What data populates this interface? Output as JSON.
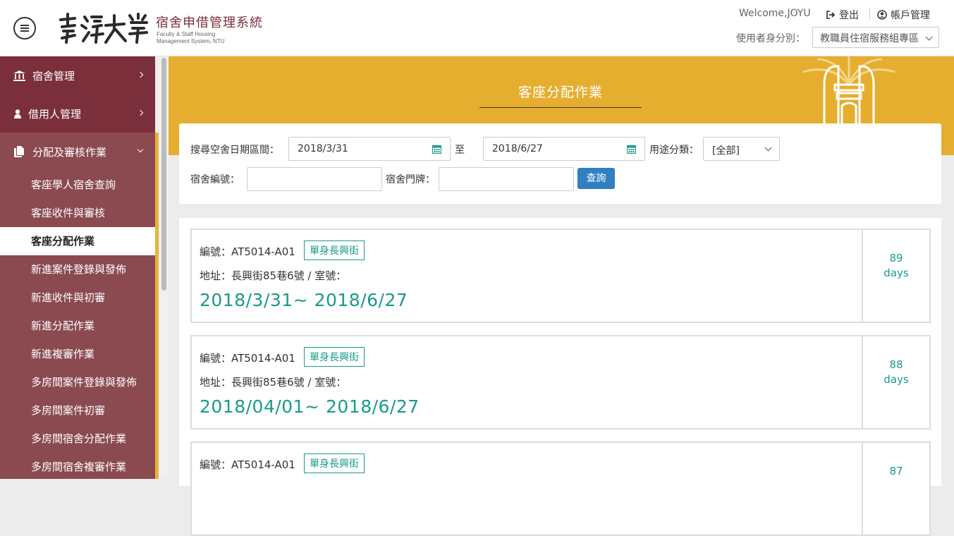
{
  "header": {
    "system_title": "宿舍申借管理系統",
    "system_subtitle_1": "Faculty & Staff Housing",
    "system_subtitle_2": "Management System, NTU",
    "welcome": "Welcome,JOYU",
    "logout_label": "登出",
    "account_label": "帳戶管理",
    "role_label": "使用者身分別：",
    "role_value": "教職員住宿服務組專區"
  },
  "sidebar": {
    "items": [
      {
        "label": "宿舍管理"
      },
      {
        "label": "借用人管理"
      },
      {
        "label": "分配及審核作業"
      }
    ],
    "subitems": [
      {
        "label": "客座學人宿舍查詢"
      },
      {
        "label": "客座收件與審核"
      },
      {
        "label": "客座分配作業"
      },
      {
        "label": "新進案件登錄與發佈"
      },
      {
        "label": "新進收件與初審"
      },
      {
        "label": "新進分配作業"
      },
      {
        "label": "新進複審作業"
      },
      {
        "label": "多房間案件登錄與發佈"
      },
      {
        "label": "多房間案件初審"
      },
      {
        "label": "多房間宿舍分配作業"
      },
      {
        "label": "多房間宿舍複審作業"
      }
    ]
  },
  "page": {
    "title": "客座分配作業"
  },
  "search": {
    "date_range_label": "搜尋空舍日期區間：",
    "date_from": "2018/3/31",
    "to_label": "至",
    "date_to": "2018/6/27",
    "usage_label": "用途分類：",
    "usage_value": "[全部]",
    "dorm_no_label": "宿舍編號：",
    "dorm_no_value": "",
    "door_label": "宿舍門牌：",
    "door_value": "",
    "query_button": "查詢"
  },
  "results": [
    {
      "no": "編號：AT5014-A01",
      "tag": "單身長興街",
      "addr": "地址：長興街85巷6號  / 室號：",
      "range": "2018/3/31~ 2018/6/27",
      "days_num": "89",
      "days_unit": "days"
    },
    {
      "no": "編號：AT5014-A01",
      "tag": "單身長興街",
      "addr": "地址：長興街85巷6號  / 室號：",
      "range": "2018/04/01~ 2018/6/27",
      "days_num": "88",
      "days_unit": "days"
    },
    {
      "no": "編號：AT5014-A01",
      "tag": "單身長興街",
      "addr": "",
      "range": "",
      "days_num": "87",
      "days_unit": ""
    }
  ],
  "colors": {
    "sidebar_top": "#7a2f3a",
    "sidebar": "#8a4a50",
    "banner": "#e6ae2f",
    "accent_teal": "#1a9a8a",
    "button_blue": "#2f7fc1"
  }
}
